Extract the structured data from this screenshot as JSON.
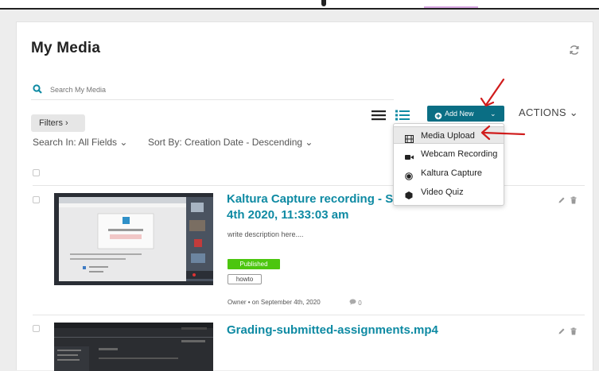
{
  "page": {
    "title": "My Media"
  },
  "search": {
    "placeholder": "Search My Media"
  },
  "toolbar": {
    "filters_label": "Filters ›",
    "add_new_label": "Add New",
    "actions_label": "ACTIONS ⌄",
    "search_in": "Search In: All Fields ⌄",
    "sort_by": "Sort By: Creation Date - Descending ⌄"
  },
  "add_new_menu": {
    "items": [
      {
        "label": "Media Upload",
        "icon": "film-icon"
      },
      {
        "label": "Webcam Recording",
        "icon": "video-camera-icon"
      },
      {
        "label": "Kaltura Capture",
        "icon": "record-icon"
      },
      {
        "label": "Video Quiz",
        "icon": "quiz-icon"
      }
    ]
  },
  "entries": [
    {
      "title": "Kaltura Capture recording - Sept 4th 2020, 11:33:03 am",
      "description": "write description here....",
      "status": "Published",
      "tag": "howto",
      "meta": "Owner • on September 4th, 2020",
      "comments": "0"
    },
    {
      "title": "Grading-submitted-assignments.mp4"
    }
  ],
  "colors": {
    "accent": "#0a6e84",
    "link": "#0e8aa3",
    "published": "#4cc60f",
    "annotation": "#d01c1c"
  }
}
